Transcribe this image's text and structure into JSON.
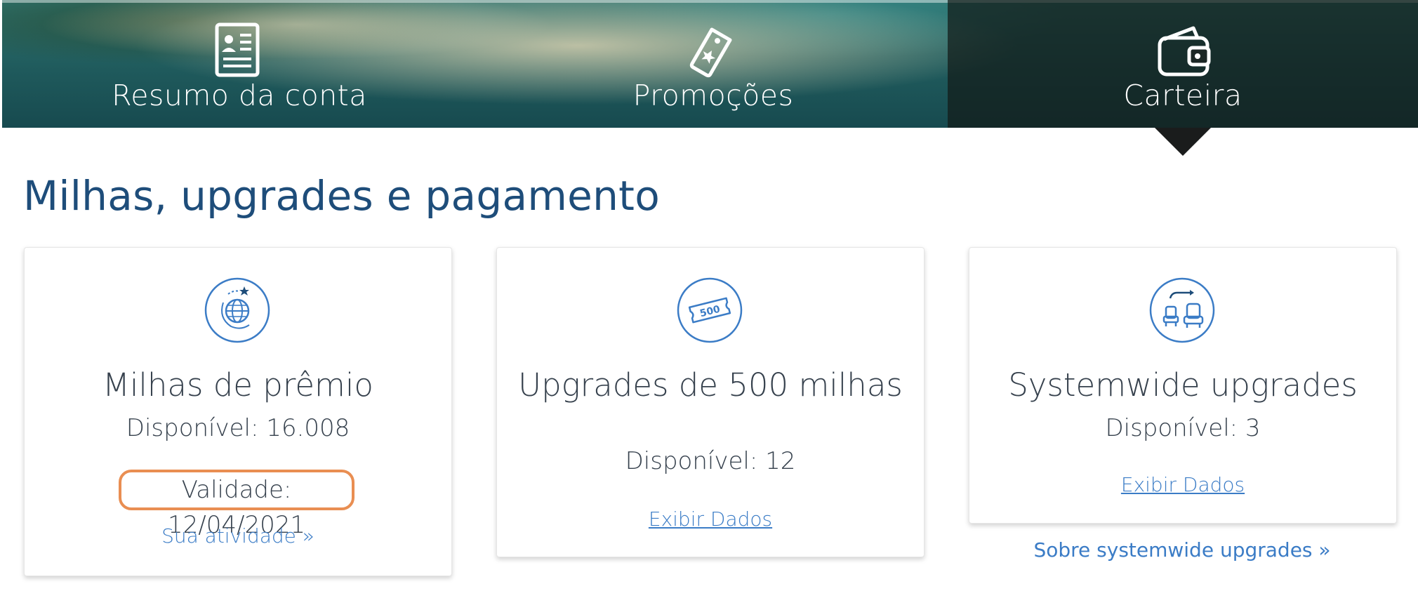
{
  "tabs": [
    {
      "label": "Resumo da conta",
      "icon": "account-card-icon"
    },
    {
      "label": "Promoções",
      "icon": "tag-star-icon"
    },
    {
      "label": "Carteira",
      "icon": "wallet-icon",
      "active": true
    }
  ],
  "section": {
    "title": "Milhas, upgrades e pagamento"
  },
  "cards": {
    "miles": {
      "icon": "globe-star-icon",
      "title": "Milhas de prêmio",
      "available": "Disponível: 16.008",
      "validity": "Validade: 12/04/2021",
      "link": "Sua atividade »"
    },
    "upgrades500": {
      "icon": "500-ticket-icon",
      "title": "Upgrades de 500 milhas",
      "available": "Disponível: 12",
      "link": "Exibir Dados"
    },
    "systemwide": {
      "icon": "seat-upgrade-icon",
      "title": "Systemwide upgrades",
      "available": "Disponível: 3",
      "link": "Exibir Dados"
    }
  },
  "about_systemwide": "Sobre systemwide upgrades  »",
  "colors": {
    "title_blue": "#1e4d7a",
    "link_blue": "#3b7cc6",
    "highlight_orange": "#e98e52",
    "text_dark": "#36414d"
  }
}
